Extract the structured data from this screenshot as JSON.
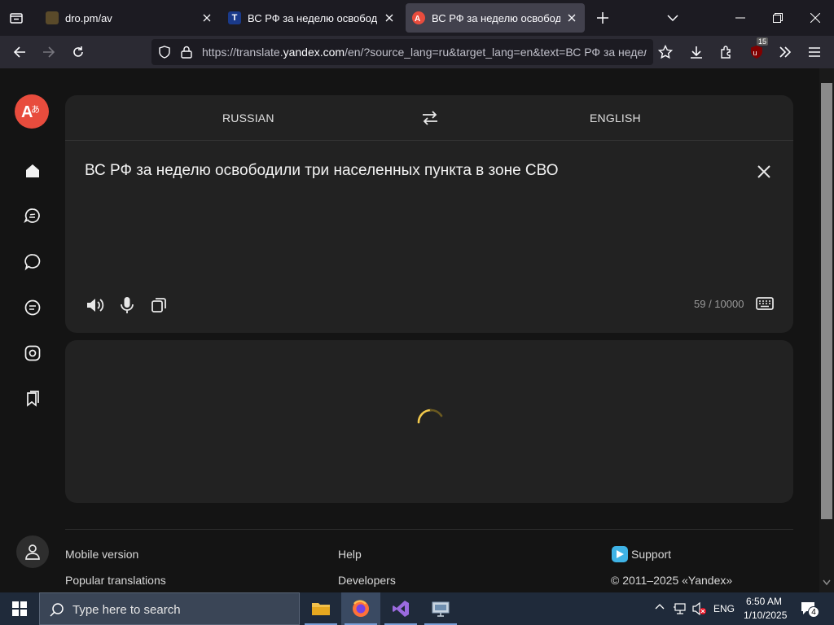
{
  "browser": {
    "tabs": [
      {
        "title": "dro.pm/av",
        "favicon": "page-icon"
      },
      {
        "title": "ВС РФ за неделю освободили",
        "favicon": "T"
      },
      {
        "title": "ВС РФ за неделю освободили",
        "favicon": "yandex-translate-icon"
      }
    ],
    "url_prefix": "https://translate.",
    "url_domain": "yandex.com",
    "url_suffix": "/en/?source_lang=ru&target_lang=en&text=ВС РФ за недел",
    "extension_badge": "15"
  },
  "translator": {
    "source_lang": "RUSSIAN",
    "target_lang": "ENGLISH",
    "source_text": "ВС РФ за неделю освободили три населенных пункта в зоне СВО",
    "counter": "59 / 10000"
  },
  "footer": {
    "mobile_version": "Mobile version",
    "popular_translations": "Popular translations",
    "help": "Help",
    "developers": "Developers",
    "support": "Support",
    "copyright": "© 2011–2025 «Yandex»"
  },
  "taskbar": {
    "search_placeholder": "Type here to search",
    "lang": "ENG",
    "time": "6:50 AM",
    "date": "1/10/2025",
    "notifications": "4"
  },
  "colors": {
    "accent": "#e84c3d",
    "spinner": "#f2c94c"
  }
}
